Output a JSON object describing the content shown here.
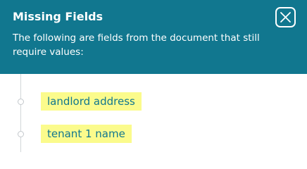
{
  "header": {
    "title": "Missing Fields",
    "description": "The following are fields from the document that still require values:"
  },
  "missing_fields": [
    {
      "label": "landlord address"
    },
    {
      "label": "tenant 1 name"
    }
  ],
  "colors": {
    "header_background": "#11778f",
    "field_highlight": "#fbfb8c",
    "field_text": "#11778f"
  }
}
